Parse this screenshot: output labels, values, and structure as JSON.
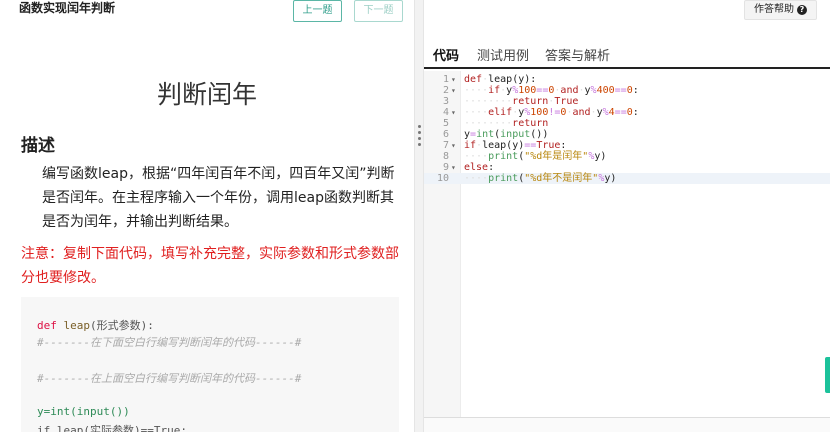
{
  "left": {
    "header_title": "函数实现闰年判断",
    "prev_label": "上一题",
    "next_label": "下一题",
    "problem_title": "判断闰年",
    "desc_heading": "描述",
    "desc_text": "编写函数leap，根据“四年闰百年不闰，四百年又闰”判断是否闰年。在主程序输入一个年份，调用leap函数判断其是否为闰年，并输出判断结果。",
    "note": "注意：复制下面代码，填写补充完整，实际参数和形式参数部分也要修改。",
    "code_lines": [
      "def leap(形式参数):",
      "#-------在下面空白行编写判断闰年的代码------#",
      "#-------在上面空白行编写判断闰年的代码------#",
      "y=int(input())",
      "if leap(实际参数)==True:"
    ]
  },
  "right": {
    "help_label": "作答帮助",
    "help_icon": "question-circle-icon",
    "tabs": [
      "代码",
      "测试用例",
      "答案与解析"
    ],
    "editor_lines": [
      {
        "n": "1",
        "fold": "▾",
        "code": "def leap(y):"
      },
      {
        "n": "2",
        "fold": "▾",
        "code": "    if y%100==0 and y%400==0:"
      },
      {
        "n": "3",
        "fold": "",
        "code": "        return True"
      },
      {
        "n": "4",
        "fold": "▾",
        "code": "    elif y%100!=0 and y%4==0:"
      },
      {
        "n": "5",
        "fold": "",
        "code": "        return"
      },
      {
        "n": "6",
        "fold": "",
        "code": "y=int(input())"
      },
      {
        "n": "7",
        "fold": "▾",
        "code": "if leap(y)==True:"
      },
      {
        "n": "8",
        "fold": "",
        "code": "    print(\"%d年是闰年\"%y)"
      },
      {
        "n": "9",
        "fold": "▾",
        "code": "else:"
      },
      {
        "n": "10",
        "fold": "",
        "code": "    print(\"%d年不是闰年\"%y)"
      }
    ]
  }
}
